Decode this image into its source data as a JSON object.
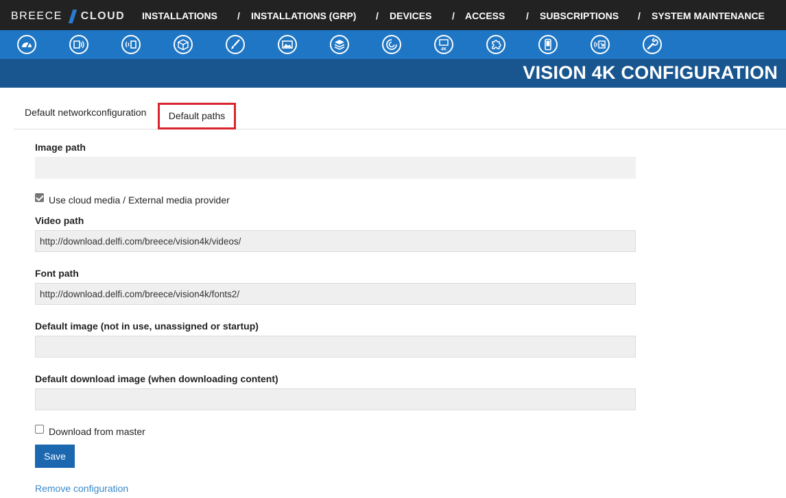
{
  "brand": {
    "part1": "BREECE",
    "part2": "CLOUD"
  },
  "nav": {
    "items": [
      {
        "label": "INSTALLATIONS"
      },
      {
        "label": "INSTALLATIONS (GRP)"
      },
      {
        "label": "DEVICES"
      },
      {
        "label": "ACCESS"
      },
      {
        "label": "SUBSCRIPTIONS"
      },
      {
        "label": "SYSTEM MAINTENANCE"
      }
    ],
    "separator": "/"
  },
  "toolbar_icons": [
    "dashboard-icon",
    "signage-screen-icon",
    "broadcast-icon",
    "package-icon",
    "brush-icon",
    "image-gallery-icon",
    "layers-icon",
    "radar-icon",
    "monitor-4k-icon",
    "puzzle-icon",
    "mobile-device-icon",
    "media-transfer-icon",
    "wrench-icon"
  ],
  "page": {
    "title": "VISION 4K CONFIGURATION"
  },
  "tabs": {
    "network": "Default networkconfiguration",
    "paths": "Default paths"
  },
  "form": {
    "image_path": {
      "label": "Image path",
      "value": ""
    },
    "cloud_media": {
      "label": "Use cloud media / External media provider",
      "checked": true
    },
    "video_path": {
      "label": "Video path",
      "value": "http://download.delfi.com/breece/vision4k/videos/"
    },
    "font_path": {
      "label": "Font path",
      "value": "http://download.delfi.com/breece/vision4k/fonts2/"
    },
    "default_image": {
      "label": "Default image (not in use, unassigned or startup)",
      "value": ""
    },
    "default_download_image": {
      "label": "Default download image (when downloading content)",
      "value": ""
    },
    "download_master": {
      "label": "Download from master",
      "checked": false
    },
    "save_label": "Save",
    "remove_label": "Remove configuration"
  },
  "colors": {
    "topbar": "#222222",
    "iconbar": "#1f76c4",
    "titleband": "#19568f",
    "active_tab_outline": "#d9232d",
    "save_button": "#1b67b0",
    "link": "#3a88c8"
  }
}
